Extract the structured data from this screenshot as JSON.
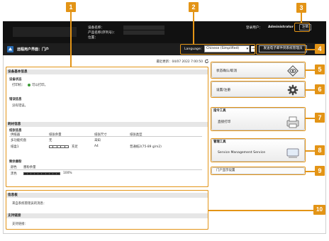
{
  "header": {
    "device_name_label": "设备名称：",
    "product_name_label": "产品名称(序列号)：",
    "location_label": "位置：",
    "login_user_label": "登录用户：",
    "login_user": "Administrator",
    "logout_label": "注销"
  },
  "titlebar": {
    "app_title": "远程用户界面：门户",
    "language_label": "Language:",
    "language_value": "Chinese (Simplified)",
    "language_go": "→",
    "mail_button": "发送电子邮件到系统管理员"
  },
  "status": {
    "last_updated": "最近更新：04/07 2022 7:00:50"
  },
  "device_basic": {
    "section_title": "设备基本信息",
    "device_status_title": "设备状态",
    "printer_label": "打印机：",
    "printer_status": "可以打印。",
    "error_title": "错误信息",
    "error_text": "没有错误。"
  },
  "consumables": {
    "section_title": "耗材信息",
    "paper_title": "纸张信息",
    "columns": [
      "供纸器",
      "纸张余量",
      "纸张尺寸",
      "纸张类型"
    ],
    "rows": [
      {
        "source": "多功能托盘",
        "remaining": "无",
        "size": "未知",
        "type": ""
      },
      {
        "source": "纸盒1",
        "remaining": "充足",
        "size": "A4",
        "type": "普通纸2(75-89 g/m2)",
        "gauge_filled": 0
      }
    ],
    "toner_title": "剩余墨粉",
    "toner_columns": [
      "颜色",
      "墨粉余量"
    ],
    "toner_rows": [
      {
        "color": "黑色",
        "percent": "100%",
        "level": 1.0
      }
    ]
  },
  "info": {
    "section_title": "信息板",
    "text": "来自系统管理员的消息："
  },
  "support": {
    "section_title": "支持链接",
    "text": "支持链接："
  },
  "right_panel": {
    "status_monitor": "状态确认/取消",
    "settings": "设置/注册",
    "quick_menu_title": "指令工具",
    "direct_print": "直接打印",
    "admin_tools_title": "管理工具",
    "service_management": "Service Management Service",
    "portal_display": "门户显示设置"
  },
  "callouts": [
    "1",
    "2",
    "3",
    "4",
    "5",
    "6",
    "7",
    "8",
    "9",
    "10"
  ],
  "colors": {
    "callout": "#e39416",
    "header_bg": "#111111",
    "ok_green": "#3c9b36"
  }
}
